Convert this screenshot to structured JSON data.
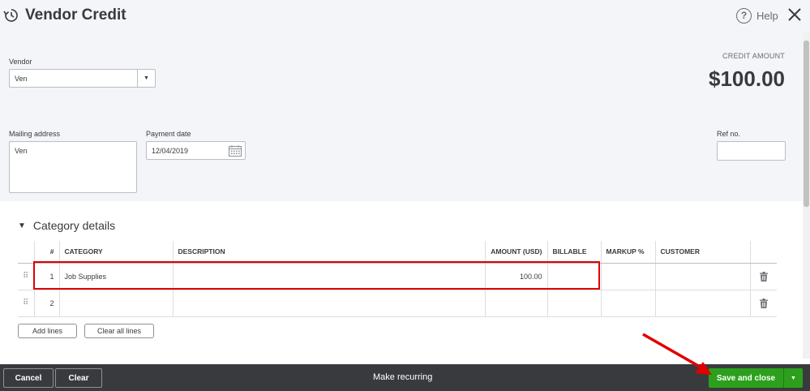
{
  "header": {
    "title": "Vendor Credit",
    "help_label": "Help",
    "help_glyph": "?"
  },
  "form": {
    "vendor_label": "Vendor",
    "vendor_value": "Ven",
    "credit_amount_label": "CREDIT AMOUNT",
    "credit_amount_value": "$100.00",
    "mailing_address_label": "Mailing address",
    "mailing_address_value": "Ven",
    "payment_date_label": "Payment date",
    "payment_date_value": "12/04/2019",
    "ref_no_label": "Ref no.",
    "ref_no_value": ""
  },
  "category": {
    "section_title": "Category details",
    "columns": [
      "#",
      "CATEGORY",
      "DESCRIPTION",
      "AMOUNT (USD)",
      "BILLABLE",
      "MARKUP %",
      "CUSTOMER"
    ],
    "rows": [
      {
        "num": "1",
        "category": "Job Supplies",
        "description": "",
        "amount": "100.00",
        "billable": "",
        "markup": "",
        "customer": ""
      },
      {
        "num": "2",
        "category": "",
        "description": "",
        "amount": "",
        "billable": "",
        "markup": "",
        "customer": ""
      }
    ],
    "add_lines_label": "Add lines",
    "clear_lines_label": "Clear all lines"
  },
  "footer": {
    "cancel_label": "Cancel",
    "clear_label": "Clear",
    "make_recurring_label": "Make recurring",
    "save_label": "Save and close"
  },
  "colors": {
    "accent_green": "#2ca01c",
    "annotation_red": "#e00000",
    "footer_bg": "#393a3d"
  }
}
